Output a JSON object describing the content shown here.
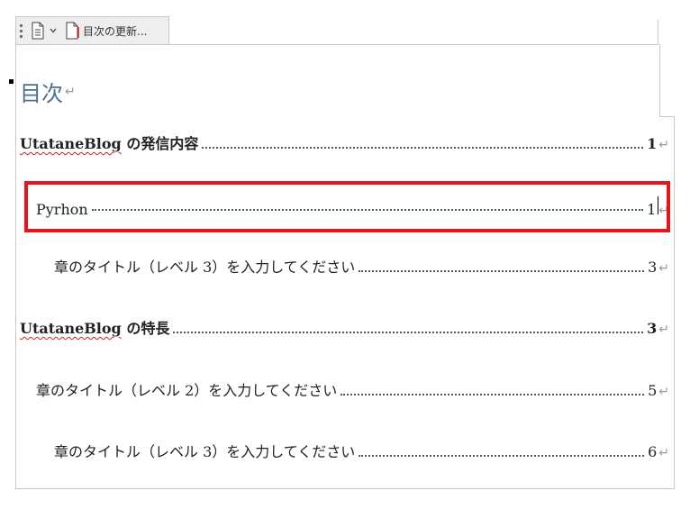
{
  "control_tab": {
    "update_label": "目次の更新..."
  },
  "toc": {
    "heading": "目次",
    "return_mark": "↵",
    "entries": [
      {
        "brand": "UtataneBlog",
        "title": " の発信内容",
        "page": "1"
      },
      {
        "title": "Pyrhon",
        "page": "1"
      },
      {
        "title": "章のタイトル（レベル 3）を入力してください",
        "page": "3"
      },
      {
        "brand": "UtataneBlog",
        "title": " の特長",
        "page": "3"
      },
      {
        "title": "章のタイトル（レベル 2）を入力してください",
        "page": "5"
      },
      {
        "title": "章のタイトル（レベル 3）を入力してください",
        "page": "6"
      }
    ]
  },
  "colors": {
    "heading": "#4f6f8f",
    "highlight": "#e8141c",
    "spell_squiggle": "#d12020"
  }
}
